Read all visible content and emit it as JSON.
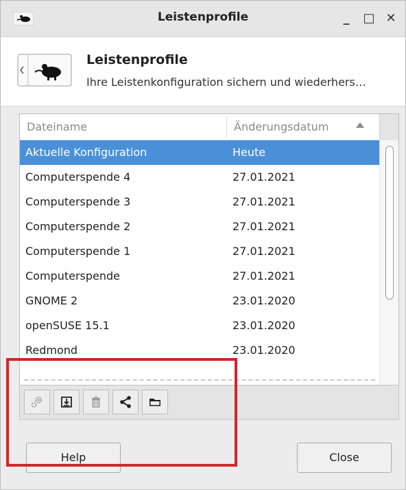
{
  "window": {
    "title": "Leistenprofile",
    "controls": {
      "minimize": "_",
      "maximize": "□",
      "close": "✕"
    }
  },
  "header": {
    "title": "Leistenprofile",
    "subtitle": "Ihre Leistenkonfiguration sichern und wiederhers…"
  },
  "table": {
    "columns": {
      "filename": "Dateiname",
      "date": "Änderungsdatum"
    },
    "sort_column": "date",
    "sort_direction": "ascending",
    "rows": [
      {
        "name": "Aktuelle Konfiguration",
        "date": "Heute",
        "selected": true
      },
      {
        "name": "Computerspende 4",
        "date": "27.01.2021"
      },
      {
        "name": "Computerspende 3",
        "date": "27.01.2021"
      },
      {
        "name": "Computerspende 2",
        "date": "27.01.2021"
      },
      {
        "name": "Computerspende 1",
        "date": "27.01.2021"
      },
      {
        "name": "Computerspende",
        "date": "27.01.2021"
      },
      {
        "name": "GNOME 2",
        "date": "23.01.2020"
      },
      {
        "name": "openSUSE 15.1",
        "date": "23.01.2020"
      },
      {
        "name": "Redmond",
        "date": "23.01.2020"
      }
    ]
  },
  "toolbar": {
    "buttons": [
      {
        "icon": "gears-icon",
        "enabled": false
      },
      {
        "icon": "save-icon",
        "enabled": true
      },
      {
        "icon": "trash-icon",
        "enabled": false
      },
      {
        "icon": "share-icon",
        "enabled": true
      },
      {
        "icon": "folder-icon",
        "enabled": true
      }
    ]
  },
  "buttons": {
    "help": "Help",
    "close": "Close"
  },
  "colors": {
    "selection": "#4a90d9",
    "highlight_box": "#d0262a"
  }
}
